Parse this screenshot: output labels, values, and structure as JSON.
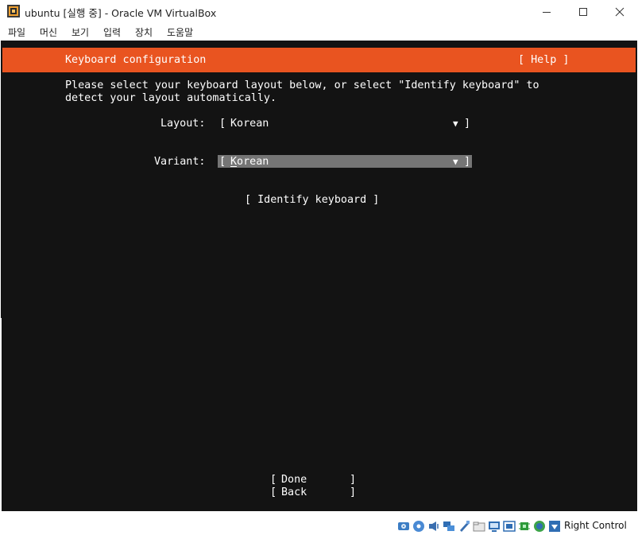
{
  "window": {
    "title": "ubuntu [실행 중] - Oracle VM VirtualBox",
    "controls": [
      "minimize",
      "maximize",
      "close"
    ]
  },
  "menubar": {
    "items": [
      "파일",
      "머신",
      "보기",
      "입력",
      "장치",
      "도움말"
    ]
  },
  "installer": {
    "header_title": "Keyboard configuration",
    "help_button": "[ Help ]",
    "intro_line1": "Please select your keyboard layout below, or select \"Identify keyboard\" to",
    "intro_line2": "detect your layout automatically.",
    "layout_label": "Layout:",
    "layout_value": "Korean",
    "variant_label": "Variant:",
    "variant_value": "Korean",
    "identify_button": "[ Identify keyboard ]",
    "done_label": "Done",
    "back_label": "Back",
    "dropdown_arrow": "▼",
    "bracket_open": "[",
    "bracket_close": "]"
  },
  "statusbar": {
    "icons": [
      "hard-disk-icon",
      "optical-drive-icon",
      "audio-icon",
      "network-icon",
      "usb-icon",
      "shared-folders-icon",
      "display-icon",
      "video-capture-icon",
      "cpu-icon",
      "mouse-integration-icon",
      "keyboard-capture-icon"
    ],
    "host_key_label": "Right Control"
  },
  "colors": {
    "accent": "#e95420",
    "vm_background": "#131313",
    "selected_field": "#757575"
  }
}
